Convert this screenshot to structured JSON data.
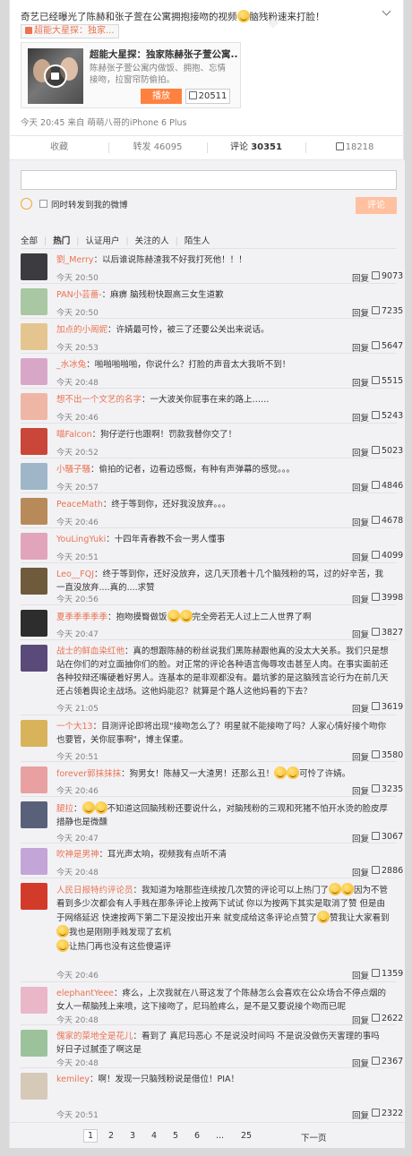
{
  "post": {
    "text": "奇艺已经曝光了陈赫和张子萱在公寓拥抱接吻的视频",
    "text_suffix": "脑残粉速来打脸！",
    "link_chip": "超能大星探：独家...",
    "video": {
      "title": "超能大星探：独家陈赫张子萱公寓...",
      "desc": "陈赫张子萱公寓内做饭、拥抱、忘情接吻，拉窗帘防偷拍。",
      "play_label": "播放",
      "likes": "20511"
    },
    "meta": "今天 20:45 来自 萌萌八哥的iPhone 6 Plus"
  },
  "actions": {
    "favorite": "收藏",
    "repost_label": "转发",
    "repost_count": "46095",
    "comment_label": "评论",
    "comment_count": "30351",
    "like_count": "18218"
  },
  "comment_box": {
    "also_repost": "同时转发到我的微博",
    "submit": "评论"
  },
  "filters": [
    "全部",
    "热门",
    "认证用户",
    "关注的人",
    "陌生人"
  ],
  "comments": [
    {
      "user": "劉_Merry",
      "text": "：以后谁说陈赫渣我不好我打死他！！！",
      "time": "今天 20:50",
      "likes": "9073",
      "avatar": "#3c3c40"
    },
    {
      "user": "PAN小芸薔-",
      "text": "：麻痹 脑残粉快跟高三女生道歉",
      "time": "今天 20:50",
      "likes": "7235",
      "avatar": "#a9c7a2"
    },
    {
      "user": "加点的小阁妮",
      "text": "：许婧最可怜，被三了还要公关出来说话。",
      "time": "今天 20:53",
      "likes": "5647",
      "avatar": "#e5c58f"
    },
    {
      "user": "_水冰兔",
      "text": "：啪啪啪啪啪，你说什么？打脸的声音太大我听不到！",
      "time": "今天 20:48",
      "likes": "5515",
      "avatar": "#d8a7c8"
    },
    {
      "user": "想不出一个文艺的名字",
      "text": "：一大波关你屁事在来的路上……",
      "time": "今天 20:46",
      "likes": "5243",
      "avatar": "#f0b6a5"
    },
    {
      "user": "喵Falcon",
      "text": "：狗仔逆行也跟啊！罚款我替你交了！",
      "time": "今天 20:52",
      "likes": "5023",
      "avatar": "#c94638"
    },
    {
      "user": "小騒子騒",
      "text": "：偷拍的记者，边看边感慨，有种有声弹幕的感觉。。。",
      "time": "今天 20:57",
      "likes": "4846",
      "avatar": "#9fb6c9"
    },
    {
      "user": "PeaceMath",
      "text": "：终于等到你，还好我没放弃。。。",
      "time": "今天 20:46",
      "likes": "4678",
      "avatar": "#b88a5a"
    },
    {
      "user": "YouLingYuki",
      "text": "：十四年青春教不会一男人懂事",
      "time": "今天 20:51",
      "likes": "4099",
      "avatar": "#e1a4ba"
    },
    {
      "user": "Leo__FQJ",
      "text": "：终于等到你，还好没放弃，这几天顶着十几个脑残粉的骂，过的好辛苦，我一直没放弃....真的....求赞",
      "time": "今天 20:56",
      "likes": "3998",
      "avatar": "#6f5a3c"
    },
    {
      "user": "夏季季季季季",
      "text": "：抱吻摸臀做饭",
      "text2": "完全旁若无人过上二人世界了啊",
      "time": "今天 20:47",
      "likes": "3827",
      "avatar": "#2d2d2d"
    },
    {
      "user": "战士的鲜血染红他",
      "text": "：真的想跟陈赫的粉丝说我们黑陈赫跟他真的没太大关系。我们只是想站在你们的对立面抽你们的脸。对正常的评论各种语言侮辱攻击甚至人肉。在事实面前还各种狡辩还嘴硬着好男人。连基本的是非观都没有。最坑爹的是这脑残言论行为在前几天还占领着舆论主战场。这他妈能忍？就算是个路人这他妈看的下去？",
      "time": "今天 21:05",
      "likes": "3619",
      "avatar": "#5a4a7a"
    },
    {
      "user": "一个大13",
      "text": "：目测评论即将出现\"接吻怎么了？明星就不能接吻了吗？人家心情好接个吻你也要管，关你屁事啊\"，博主保重。",
      "time": "今天 20:51",
      "likes": "3580",
      "avatar": "#d9b35a"
    },
    {
      "user": "forever郭抹抹抹",
      "text": "：狗男女！陈赫又一大渣男！还那么丑！",
      "text2": "可怜了许婧。",
      "time": "今天 20:46",
      "likes": "3235",
      "avatar": "#e8a0a0"
    },
    {
      "user": "腿拉",
      "text": "：",
      "text2": "不知道这回脑残粉还要说什么，对脑残粉的三观和死猪不怕开水烫的脸皮厚措静也是微醺",
      "time": "今天 20:47",
      "likes": "3067",
      "avatar": "#59607a"
    },
    {
      "user": "吹神是男神",
      "text": "：耳光声太响，视频我有点听不清",
      "time": "今天 20:48",
      "likes": "2886",
      "avatar": "#c4a5d8"
    },
    {
      "user": "人民日报特约评论员",
      "text": "：我知道为啥那些连续按几次赞的评论可以上热门了",
      "text2": "因为不管看到多少次都会有人手贱在那条评论上按两下试试 你以为按两下其实是取消了赞 但是由于网络延迟 快速按两下第二下是没按出开来 就变成给这条评论点赞了",
      "text3": "赞我让大家看到",
      "text4": "我也是刚刚手贱发现了玄机",
      "text5": "让热门再也没有这些傻逼评",
      "time": "今天 20:46",
      "likes": "1359",
      "avatar": "#d23b2a"
    },
    {
      "user": "elephantYeee",
      "text": "：疼么，上次我就在八哥这发了个陈赫怎么会喜欢在公众场合不停点烟的女人一帮脑残上来喷，这下接吻了，尼玛脸疼么，是不是又要说接个吻而已呢",
      "time": "今天 20:48",
      "likes": "2622",
      "avatar": "#e9b7c8"
    },
    {
      "user": "傀家的菜地全是花儿",
      "text": "：看到了 真尼玛恶心 不是说没时间吗 不是说没做伤天害理的事吗 好日子过腻歪了啊这是",
      "time": "今天 20:48",
      "likes": "2367",
      "avatar": "#9bc29a"
    },
    {
      "user": "kemiley",
      "text": "：啊！发现一只脑残粉说是借位！PIA！",
      "time": "今天 20:51",
      "likes": "2322",
      "avatar": "#d6c9b8"
    }
  ],
  "reply_label": "回复",
  "pager": {
    "pages": [
      "1",
      "2",
      "3",
      "4",
      "5",
      "6",
      "...",
      "25"
    ],
    "next": "下一页"
  },
  "colors": {
    "accent": "#eb7350",
    "play_button": "#ff8140",
    "submit_button": "#ffc09f",
    "panel_bg": "#f2f2f5"
  }
}
